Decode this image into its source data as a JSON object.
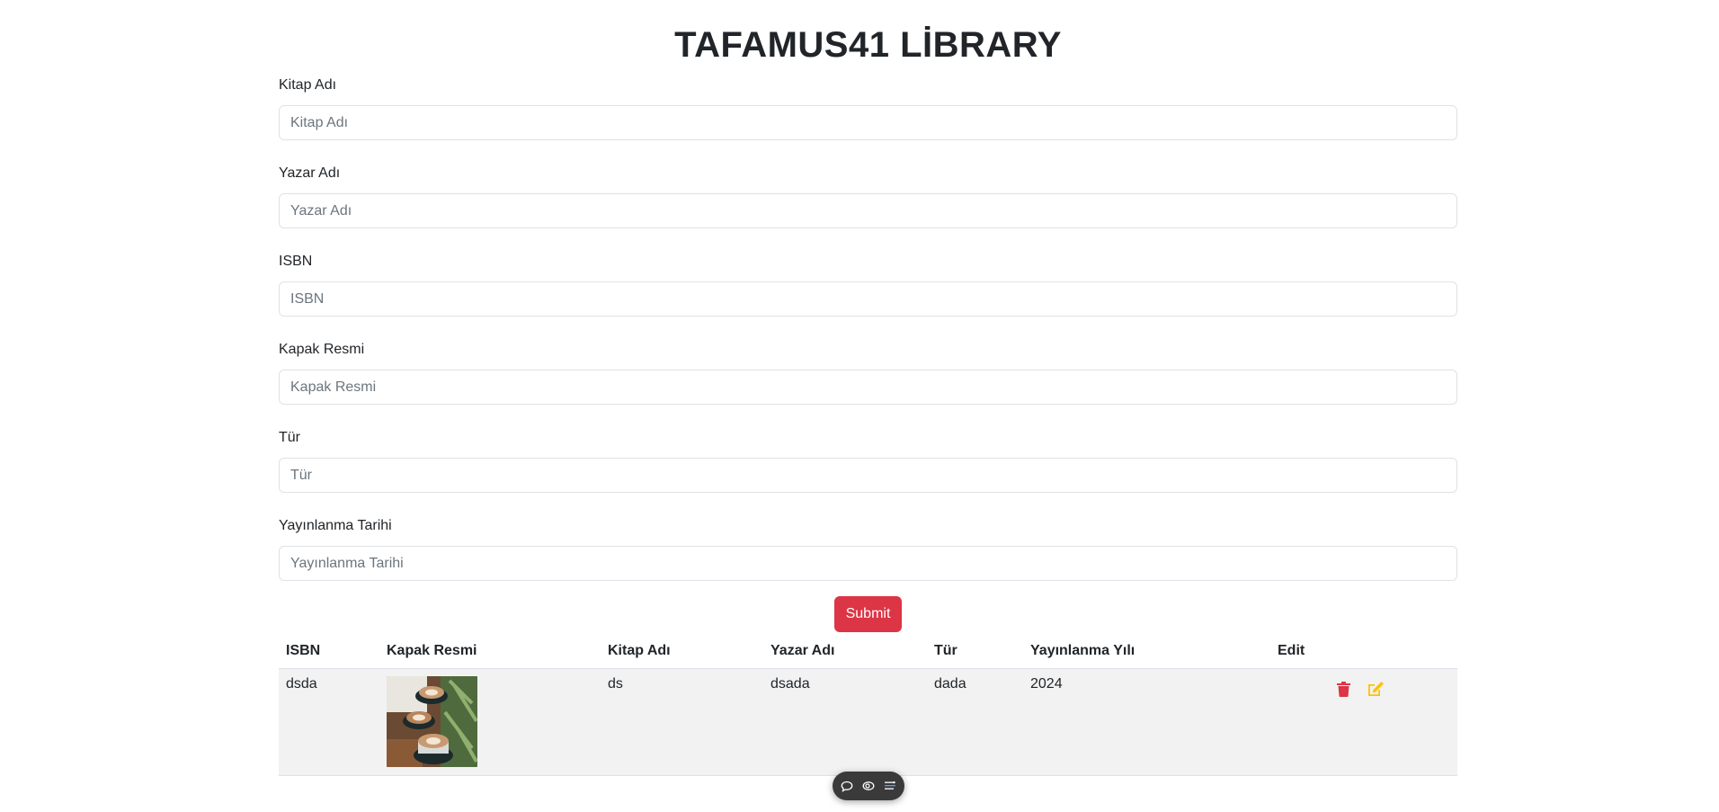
{
  "page": {
    "title": "TAFAMUS41 LİBRARY"
  },
  "form": {
    "fields": [
      {
        "label": "Kitap Adı",
        "placeholder": "Kitap Adı",
        "value": ""
      },
      {
        "label": "Yazar Adı",
        "placeholder": "Yazar Adı",
        "value": ""
      },
      {
        "label": "ISBN",
        "placeholder": "ISBN",
        "value": ""
      },
      {
        "label": "Kapak Resmi",
        "placeholder": "Kapak Resmi",
        "value": ""
      },
      {
        "label": "Tür",
        "placeholder": "Tür",
        "value": ""
      },
      {
        "label": "Yayınlanma Tarihi",
        "placeholder": "Yayınlanma Tarihi",
        "value": ""
      }
    ],
    "submit_label": "Submit"
  },
  "table": {
    "headers": [
      "ISBN",
      "Kapak Resmi",
      "Kitap Adı",
      "Yazar Adı",
      "Tür",
      "Yayınlanma Yılı",
      "Edit"
    ],
    "rows": [
      {
        "isbn": "dsda",
        "cover_icon": "coffee-cups-image",
        "kitap_adi": "ds",
        "yazar_adi": "dsada",
        "tur": "dada",
        "yayinlanma_yili": "2024"
      }
    ]
  },
  "icons": {
    "delete": "trash-icon",
    "edit": "pencil-square-icon"
  },
  "colors": {
    "submit": "#dc3545",
    "delete_icon": "#dc3545",
    "edit_icon": "#ffc107",
    "row_bg": "#f2f2f2",
    "toolbar_bg": "#3a3a3a"
  },
  "floating_toolbar": {
    "icons": [
      "comment-icon",
      "eye-icon",
      "list-settings-icon"
    ]
  }
}
